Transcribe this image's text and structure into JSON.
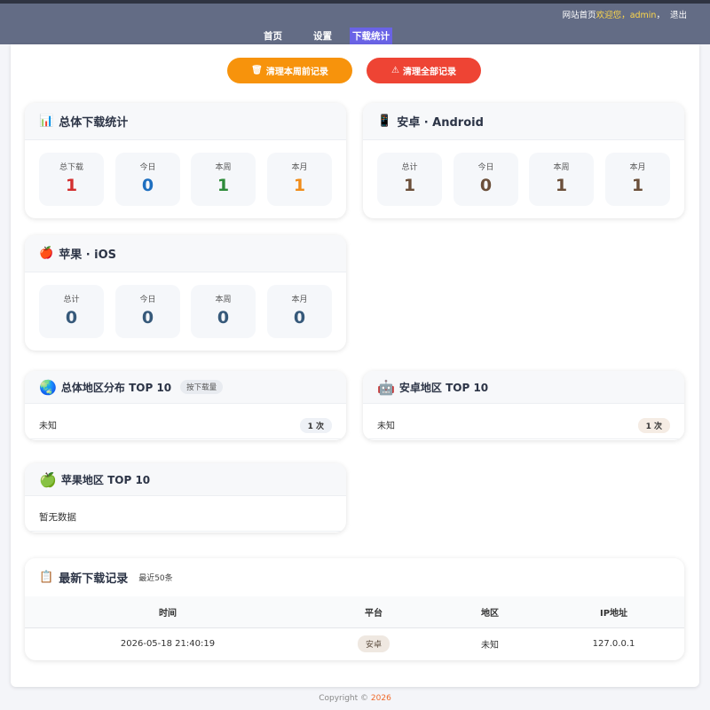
{
  "topbar": {
    "site_home": "网站首页",
    "welcome_prefix": "欢迎您，",
    "username": "admin",
    "logout": "退出"
  },
  "nav": [
    {
      "label": "首页",
      "active": false
    },
    {
      "label": "设置",
      "active": false
    },
    {
      "label": "下载统计",
      "active": true
    }
  ],
  "actions": {
    "clear_week": "清理本周前记录",
    "clear_all": "清理全部记录"
  },
  "overall": {
    "title": "总体下载统计",
    "icon": "bar-chart-icon",
    "stats": [
      {
        "label": "总下载",
        "value": "1",
        "color": "#d32f2f"
      },
      {
        "label": "今日",
        "value": "0",
        "color": "#1e6fc0"
      },
      {
        "label": "本周",
        "value": "1",
        "color": "#2e8b3a"
      },
      {
        "label": "本月",
        "value": "1",
        "color": "#f08c1a"
      }
    ]
  },
  "android": {
    "title": "安卓 · Android",
    "icon": "phone-icon",
    "stats": [
      {
        "label": "总计",
        "value": "1",
        "color": "#6b4f3a"
      },
      {
        "label": "今日",
        "value": "0",
        "color": "#6b4f3a"
      },
      {
        "label": "本周",
        "value": "1",
        "color": "#6b4f3a"
      },
      {
        "label": "本月",
        "value": "1",
        "color": "#6b4f3a"
      }
    ]
  },
  "ios": {
    "title": "苹果 · iOS",
    "icon": "apple-icon",
    "stats": [
      {
        "label": "总计",
        "value": "0",
        "color": "#36597a"
      },
      {
        "label": "今日",
        "value": "0",
        "color": "#36597a"
      },
      {
        "label": "本周",
        "value": "0",
        "color": "#36597a"
      },
      {
        "label": "本月",
        "value": "0",
        "color": "#36597a"
      }
    ]
  },
  "region_overall": {
    "title": "总体地区分布 TOP 10",
    "tag": "按下载量",
    "rows": [
      {
        "name": "未知",
        "count": "1 次"
      }
    ]
  },
  "region_android": {
    "title": "安卓地区 TOP 10",
    "rows": [
      {
        "name": "未知",
        "count": "1 次"
      }
    ]
  },
  "region_ios": {
    "title": "苹果地区 TOP 10",
    "empty": "暂无数据"
  },
  "log": {
    "title": "最新下载记录",
    "subtitle": "最近50条",
    "columns": [
      "时间",
      "平台",
      "地区",
      "IP地址"
    ],
    "rows": [
      {
        "time": "2026-05-18 21:40:19",
        "platform": "安卓",
        "region": "未知",
        "ip": "127.0.0.1"
      }
    ]
  },
  "footer": {
    "copyright": "Copyright © ",
    "year": "2026"
  }
}
